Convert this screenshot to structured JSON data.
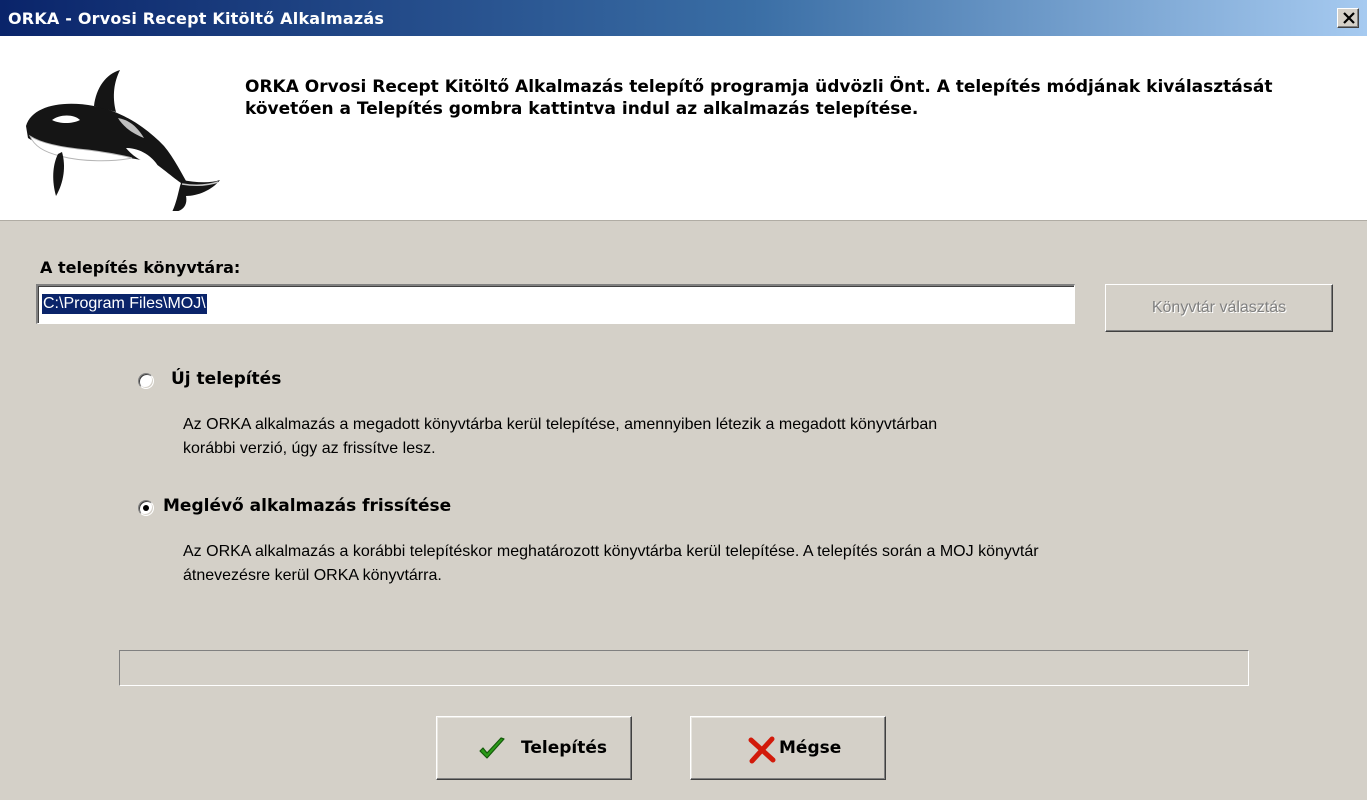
{
  "window": {
    "title": "ORKA - Orvosi Recept Kitöltő Alkalmazás",
    "close_icon": "close-icon"
  },
  "header": {
    "logo_icon": "orca-logo",
    "welcome_text": "ORKA Orvosi Recept Kitöltő Alkalmazás telepítő programja üdvözli Önt. A telepítés módjának kiválasztását követően a Telepítés gombra kattintva indul az alkalmazás telepítése."
  },
  "install_dir": {
    "label": "A telepítés könyvtára:",
    "value": "C:\\Program Files\\MOJ\\",
    "browse_label": "Könyvtár választás",
    "browse_enabled": false
  },
  "options": {
    "new_install": {
      "label": "Új telepítés",
      "description": "Az ORKA alkalmazás a megadott könyvtárba kerül telepítése, amennyiben létezik a megadott könyvtárban korábbi verzió, úgy az frissítve lesz.",
      "selected": false
    },
    "upgrade": {
      "label": "Meglévő alkalmazás frissítése",
      "description": "Az ORKA alkalmazás a korábbi telepítéskor meghatározott könyvtárba kerül telepítése. A telepítés során a MOJ könyvtár átnevezésre kerül ORKA könyvtárra.",
      "selected": true
    }
  },
  "progress": {
    "value": 0
  },
  "buttons": {
    "install_label": "Telepítés",
    "install_icon": "checkmark-icon",
    "cancel_label": "Mégse",
    "cancel_icon": "cross-icon"
  },
  "colors": {
    "titlebar_start": "#0a246a",
    "titlebar_end": "#a6caf0",
    "face": "#d4d0c8",
    "check_green": "#2a9a18",
    "cross_red": "#d21a0a"
  }
}
